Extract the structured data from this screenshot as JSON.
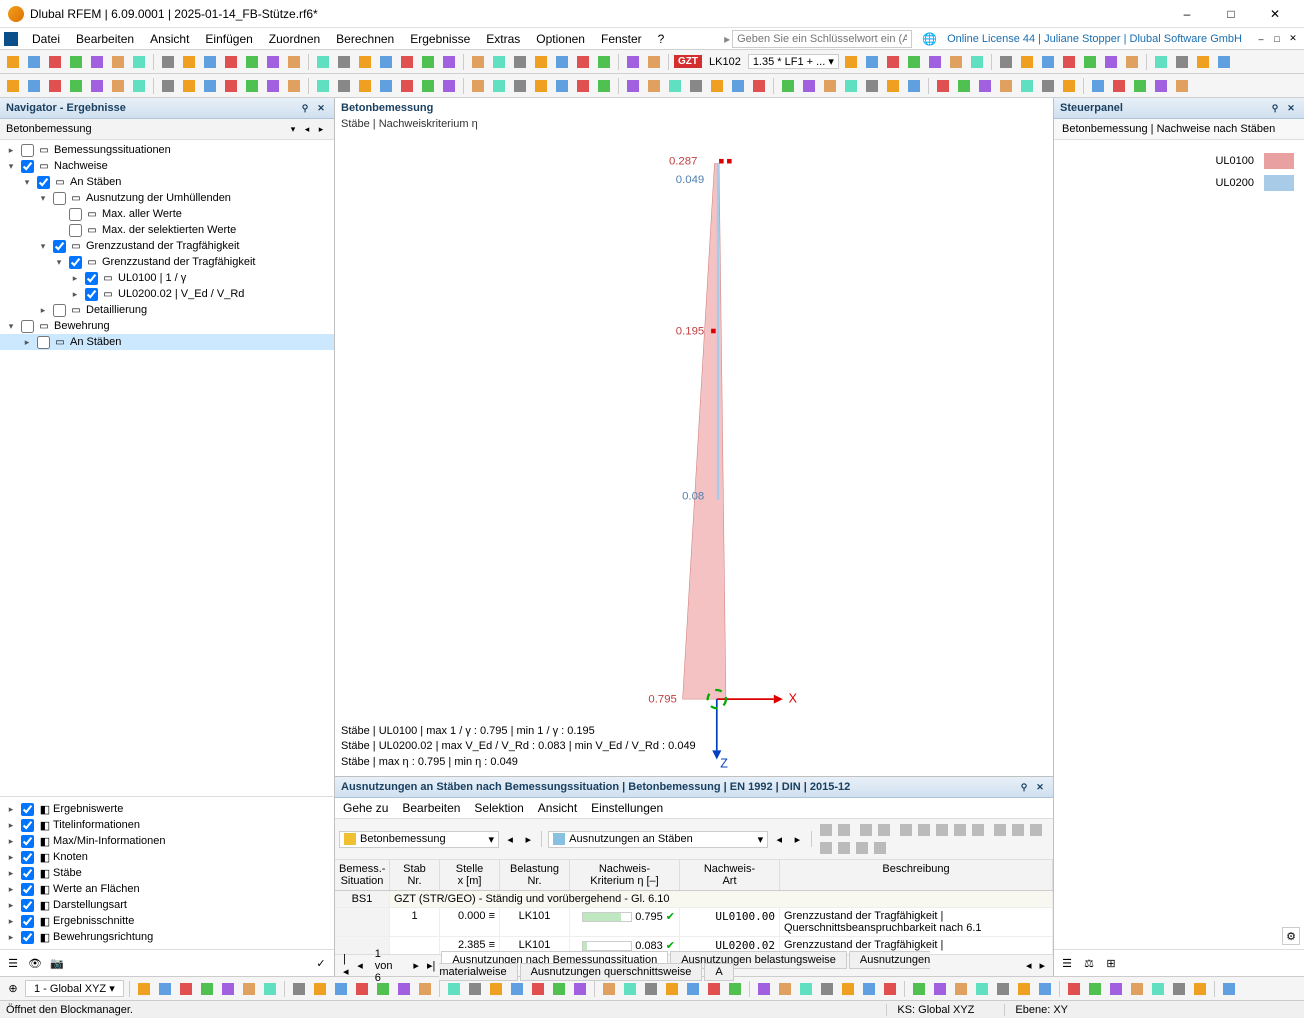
{
  "title": "Dlubal RFEM | 6.09.0001 | 2025-01-14_FB-Stütze.rf6*",
  "window_buttons": {
    "min": "–",
    "max": "□",
    "close": "✕"
  },
  "menu": [
    "Datei",
    "Bearbeiten",
    "Ansicht",
    "Einfügen",
    "Zuordnen",
    "Berechnen",
    "Ergebnisse",
    "Extras",
    "Optionen",
    "Fenster",
    "?"
  ],
  "search_placeholder": "Geben Sie ein Schlüsselwort ein (Alt...",
  "license_info": "Online License 44 | Juliane Stopper | Dlubal Software GmbH",
  "doc_ctrl": {
    "min": "–",
    "max": "□",
    "close": "✕"
  },
  "toolbar_badge": "GZT",
  "toolbar_lk": "LK102",
  "toolbar_combo": "1.35 * LF1 + ...",
  "navigator": {
    "title": "Navigator - Ergebnisse",
    "sub": "Betonbemessung",
    "tree": [
      {
        "ind": 0,
        "exp": ">",
        "chk": false,
        "label": "Bemessungssituationen"
      },
      {
        "ind": 0,
        "exp": "v",
        "chk": true,
        "label": "Nachweise"
      },
      {
        "ind": 1,
        "exp": "v",
        "chk": true,
        "label": "An Stäben"
      },
      {
        "ind": 2,
        "exp": "v",
        "chk": false,
        "label": "Ausnutzung der Umhüllenden"
      },
      {
        "ind": 3,
        "exp": "",
        "chk": false,
        "label": "Max. aller Werte"
      },
      {
        "ind": 3,
        "exp": "",
        "chk": false,
        "label": "Max. der selektierten Werte"
      },
      {
        "ind": 2,
        "exp": "v",
        "chk": true,
        "label": "Grenzzustand der Tragfähigkeit"
      },
      {
        "ind": 3,
        "exp": "v",
        "chk": true,
        "label": "Grenzzustand der Tragfähigkeit"
      },
      {
        "ind": 4,
        "exp": ">",
        "chk": true,
        "label": "UL0100 | 1 / γ"
      },
      {
        "ind": 4,
        "exp": ">",
        "chk": true,
        "label": "UL0200.02 | V_Ed / V_Rd"
      },
      {
        "ind": 2,
        "exp": ">",
        "chk": false,
        "label": "Detaillierung"
      },
      {
        "ind": 0,
        "exp": "v",
        "chk": false,
        "label": "Bewehrung"
      },
      {
        "ind": 1,
        "exp": ">",
        "chk": false,
        "label": "An Stäben",
        "selected": true
      }
    ],
    "checks": [
      {
        "label": "Ergebniswerte",
        "chk": true
      },
      {
        "label": "Titelinformationen",
        "chk": true
      },
      {
        "label": "Max/Min-Informationen",
        "chk": true
      },
      {
        "label": "Knoten",
        "chk": true
      },
      {
        "label": "Stäbe",
        "chk": true
      },
      {
        "label": "Werte an Flächen",
        "chk": true
      },
      {
        "label": "Darstellungsart",
        "chk": true
      },
      {
        "label": "Ergebnisschnitte",
        "chk": true
      },
      {
        "label": "Bewehrungsrichtung",
        "chk": true
      }
    ]
  },
  "viewport": {
    "title": "Betonbemessung",
    "subtitle": "Stäbe | Nachweiskriterium η",
    "labels": {
      "top1": "0.287",
      "top2": "0.049",
      "mid": "0.195",
      "low": "0.08",
      "bottom": "0.795",
      "x": "X",
      "z": "Z"
    },
    "info": [
      "Stäbe | UL0100 | max 1 / γ : 0.795 | min 1 / γ : 0.195",
      "Stäbe | UL0200.02 | max V_Ed / V_Rd : 0.083 | min V_Ed / V_Rd : 0.049",
      "Stäbe | max η : 0.795 | min η : 0.049"
    ]
  },
  "chart_data": {
    "type": "line",
    "title": "Stäbe | Nachweiskriterium η",
    "series": [
      {
        "name": "UL0100 1/γ",
        "color": "#e57373",
        "points": [
          {
            "pos": "top",
            "value": 0.287
          },
          {
            "pos": "mid",
            "value": 0.195
          },
          {
            "pos": "bottom",
            "value": 0.795
          }
        ]
      },
      {
        "name": "UL0200 V_Ed/V_Rd",
        "color": "#90c4e9",
        "points": [
          {
            "pos": "top",
            "value": 0.049
          },
          {
            "pos": "low",
            "value": 0.08
          }
        ]
      }
    ],
    "axis_labels": {
      "x": "X",
      "z": "Z"
    },
    "summary": {
      "max_eta": 0.795,
      "min_eta": 0.049
    }
  },
  "results": {
    "title": "Ausnutzungen an Stäben nach Bemessungssituation | Betonbemessung | EN 1992 | DIN | 2015-12",
    "menu": [
      "Gehe zu",
      "Bearbeiten",
      "Selektion",
      "Ansicht",
      "Einstellungen"
    ],
    "sel1": "Betonbemessung",
    "sel2": "Ausnutzungen an Stäben",
    "columns": [
      "Bemess.-\nSituation",
      "Stab\nNr.",
      "Stelle\nx [m]",
      "Belastung\nNr.",
      "Nachweis-\nKriterium η [–]",
      "Nachweis-\nArt",
      "Beschreibung"
    ],
    "group": "GZT (STR/GEO) - Ständig und vorübergehend - Gl. 6.10",
    "group_key": "BS1",
    "rows": [
      {
        "stab": "1",
        "x": "0.000",
        "bel": "LK101",
        "krit": "0.795",
        "ok": true,
        "art": "UL0100.00",
        "beschr": "Grenzzustand der Tragfähigkeit | Querschnittsbeanspruchbarkeit nach 6.1"
      },
      {
        "stab": "",
        "x": "2.385",
        "bel": "LK101",
        "krit": "0.083",
        "ok": true,
        "art": "UL0200.02",
        "beschr": "Grenzzustand der Tragfähigkeit | Schubbeanspruchbarkeit - Bewehrungsschubtragfähigkeit"
      }
    ],
    "paging": "1 von 6",
    "tabs": [
      "Ausnutzungen nach Bemessungssituation",
      "Ausnutzungen belastungsweise",
      "Ausnutzungen materialweise",
      "Ausnutzungen querschnittsweise",
      "A"
    ],
    "active_tab": 0
  },
  "steuer": {
    "title": "Steuerpanel",
    "subtitle": "Betonbemessung | Nachweise nach Stäben",
    "legend": [
      {
        "label": "UL0100",
        "color": "#e8a0a0"
      },
      {
        "label": "UL0200",
        "color": "#a8cce8"
      }
    ]
  },
  "bottom_coord_label": "1 - Global XYZ",
  "status": {
    "msg": "Öffnet den Blockmanager.",
    "ks": "KS: Global XYZ",
    "ebene": "Ebene: XY"
  }
}
